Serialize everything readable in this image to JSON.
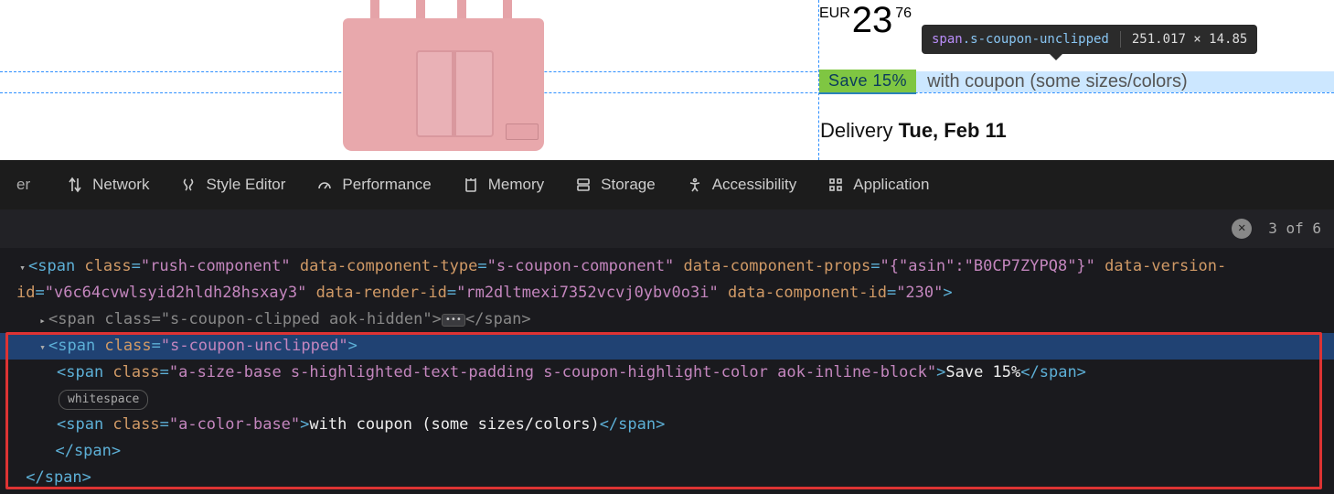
{
  "product": {
    "currency": "EUR",
    "price_whole": "23",
    "price_cents": "76",
    "save_badge": "Save 15%",
    "coupon_text": "with coupon (some sizes/colors)",
    "delivery_label": "Delivery ",
    "delivery_date": "Tue, Feb 11"
  },
  "tooltip": {
    "tag": "span",
    "class": ".s-coupon-unclipped",
    "dims": "251.017 × 14.85"
  },
  "toolbar": {
    "left_cut": "er",
    "items": [
      "Network",
      "Style Editor",
      "Performance",
      "Memory",
      "Storage",
      "Accessibility",
      "Application"
    ]
  },
  "searchbar": {
    "count": "3 of 6"
  },
  "dom": {
    "l1_open": "<span class=\"rush-component\" data-component-type=\"s-coupon-component\" data-component-props=\"{\"asin\":\"B0CP7ZYPQ8\"}\" data-version-",
    "l1_cont": "id=\"v6c64cvwlsyid2hldh28hsxay3\" data-render-id=\"rm2dltmexi7352vcvj0ybv0o3i\" data-component-id=\"230\">",
    "l2": "<span class=\"s-coupon-clipped aok-hidden\">",
    "l3": "<span class=\"s-coupon-unclipped\">",
    "l4_open": "<span class=\"a-size-base s-highlighted-text-padding s-coupon-highlight-color aok-inline-block\">",
    "l4_text": "Save 15%",
    "l5_ws": "whitespace",
    "l6_open": "<span class=\"a-color-base\">",
    "l6_text": "with coupon (some sizes/colors)",
    "l7": "</span>",
    "l8": "</span>"
  }
}
